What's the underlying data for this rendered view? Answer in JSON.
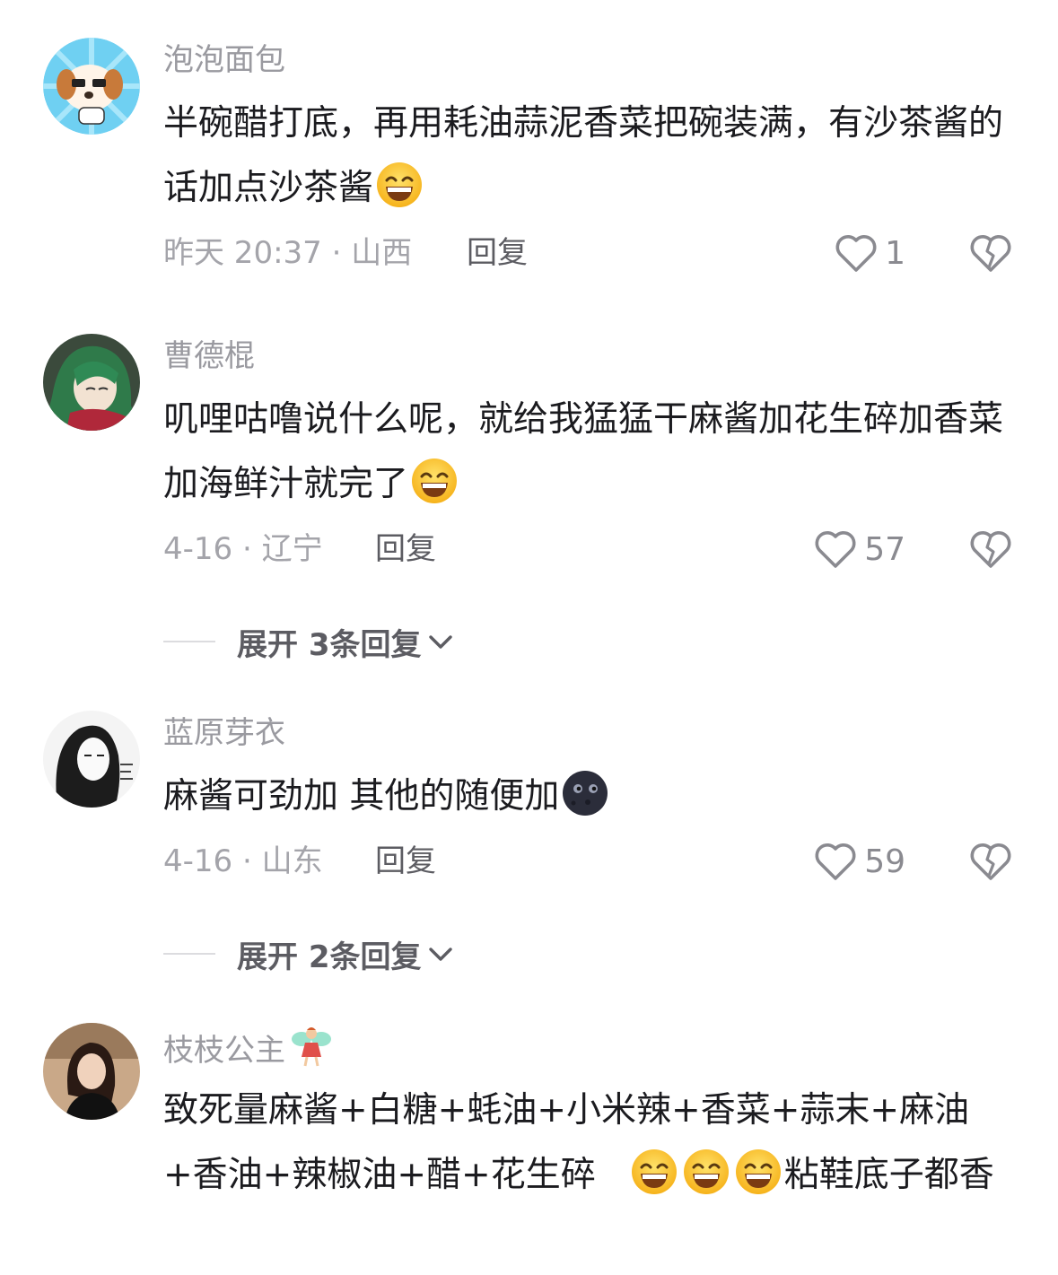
{
  "comments": [
    {
      "username": "泡泡面包",
      "body_parts": [
        "半碗醋打底，再用耗油蒜泥香菜把碗装满，有沙茶酱的话加点沙茶酱"
      ],
      "emoji_end": [
        "grinning-squint-emoji"
      ],
      "meta": "昨天 20:37 · 山西",
      "reply_label": "回复",
      "likes": "1"
    },
    {
      "username": "曹德棍",
      "body_parts": [
        "叽哩咕噜说什么呢，就给我猛猛干麻酱加花生碎加香菜加海鲜汁就完了"
      ],
      "emoji_end": [
        "grinning-squint-emoji"
      ],
      "meta": "4-16 · 辽宁",
      "reply_label": "回复",
      "likes": "57",
      "expand_label": "展开 3条回复"
    },
    {
      "username": "蓝原芽衣",
      "body_parts": [
        "麻酱可劲加 其他的随便加"
      ],
      "emoji_end": [
        "new-moon-face-emoji"
      ],
      "meta": "4-16 · 山东",
      "reply_label": "回复",
      "likes": "59",
      "expand_label": "展开 2条回复"
    },
    {
      "username": "枝枝公主",
      "username_icon": "fairy-emoji",
      "body_part_a": "致死量麻酱+白糖+蚝油+小米辣+香菜+蒜末+麻油+香油+辣椒油+醋+花生碎",
      "body_part_b": "粘鞋底子都香",
      "emoji_mid": [
        "grinning-squint-emoji",
        "grinning-squint-emoji",
        "grinning-squint-emoji"
      ]
    }
  ],
  "colors": {
    "username": "#9a9aa0",
    "body_text": "#1b1b1f",
    "meta": "#a4a4aa",
    "reply": "#5c5c62",
    "background": "#ffffff"
  }
}
